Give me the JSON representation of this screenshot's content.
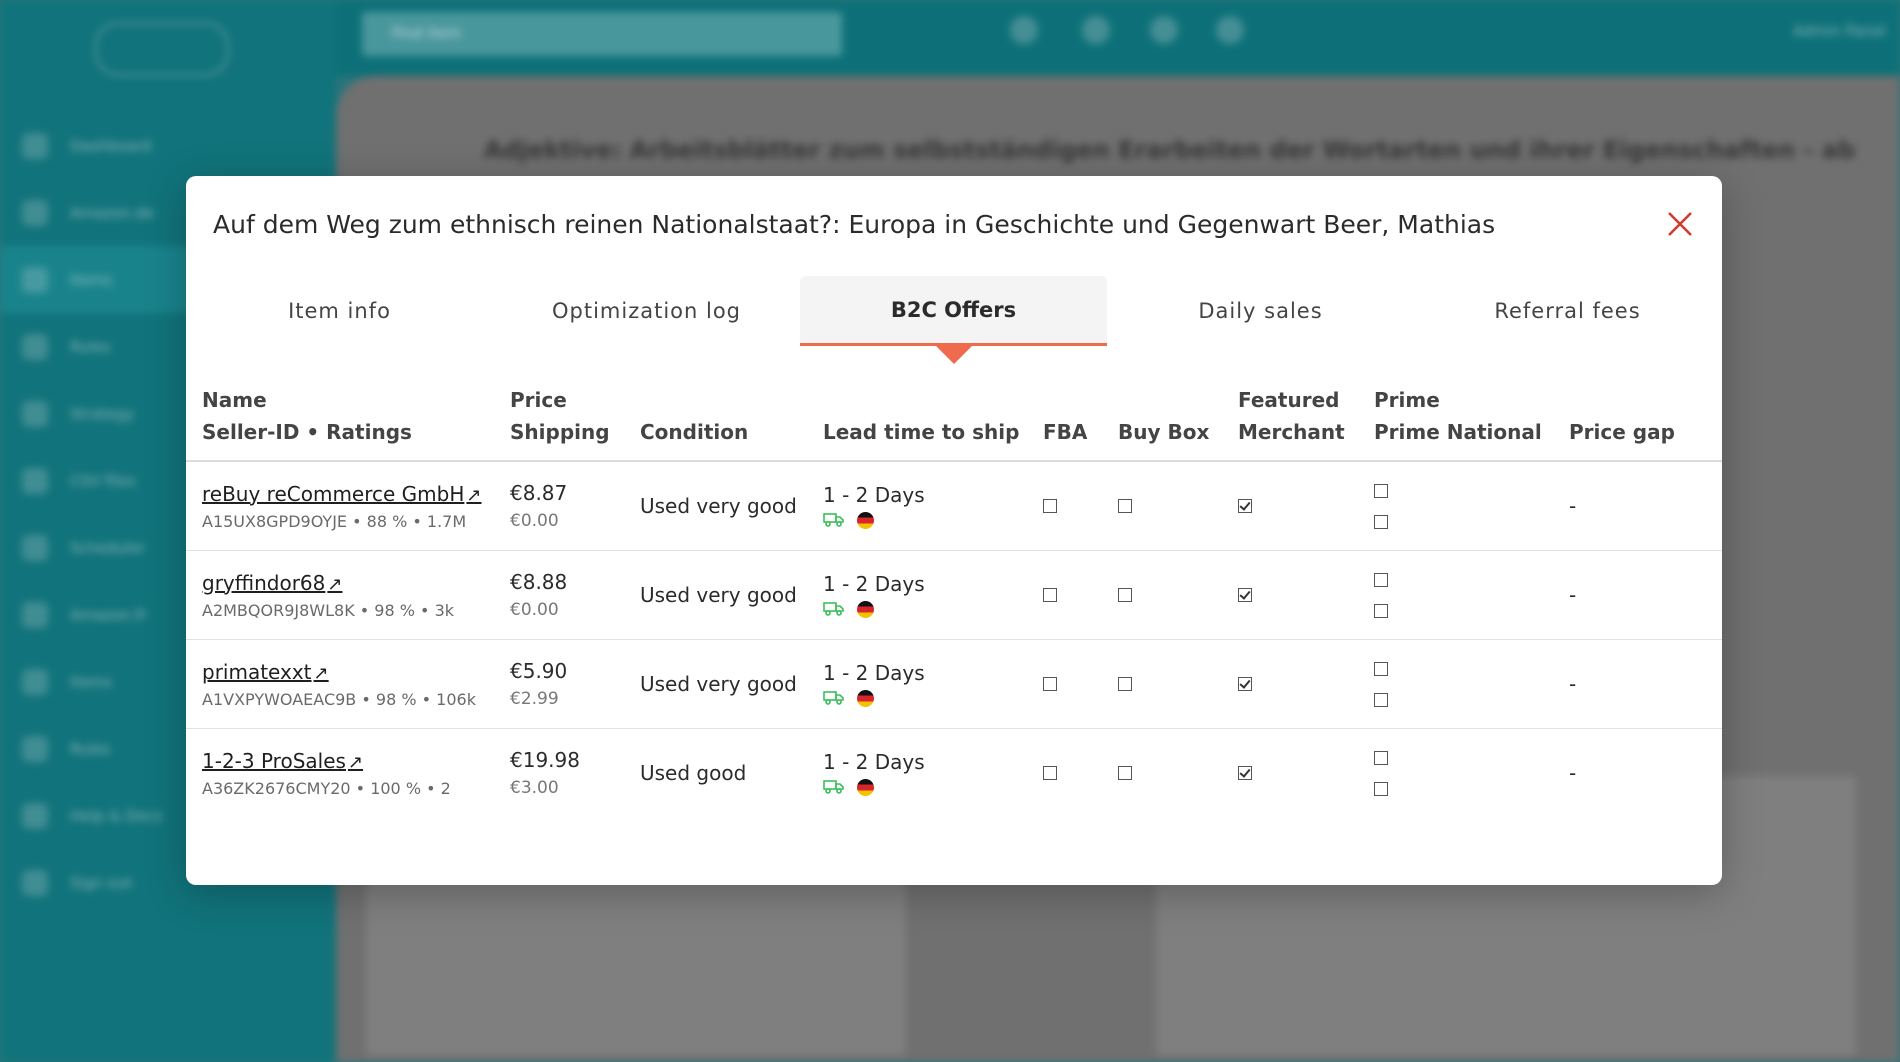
{
  "background": {
    "search_placeholder": "Find item",
    "user_label": "Admin Panel",
    "nav_items": [
      "Dashboard",
      "Amazon.de",
      "Items",
      "Rules",
      "Strategy",
      "CSV files",
      "Scheduler",
      "Amazon.fr",
      "Items",
      "Rules",
      "Help & Docs",
      "Sign out"
    ],
    "main_title": "Adjektive: Arbeitsblätter zum selbstständigen Erarbeiten der Wortarten und ihrer Eigenschaften - ab"
  },
  "modal": {
    "title": "Auf dem Weg zum ethnisch reinen Nationalstaat?: Europa in Geschichte und Gegenwart Beer, Mathias",
    "close_icon": "close-icon",
    "tabs": [
      {
        "label": "Item info",
        "active": false
      },
      {
        "label": "Optimization log",
        "active": false
      },
      {
        "label": "B2C Offers",
        "active": true
      },
      {
        "label": "Daily sales",
        "active": false
      },
      {
        "label": "Referral fees",
        "active": false
      }
    ],
    "columns": {
      "name_line1": "Name",
      "name_line2": "Seller-ID • Ratings",
      "price_line1": "Price",
      "price_line2": "Shipping",
      "condition": "Condition",
      "lead_time": "Lead time to ship",
      "fba": "FBA",
      "buy_box": "Buy Box",
      "featured_line1": "Featured",
      "featured_line2": "Merchant",
      "prime_line1": "Prime",
      "prime_line2": "Prime National",
      "price_gap": "Price gap"
    },
    "offers": [
      {
        "name": "reBuy reCommerce GmbH",
        "ext_icon": "↗",
        "sub": "A15UX8GPD9OYJE • 88 % • 1.7M",
        "price": "€8.87",
        "shipping": "€0.00",
        "condition": "Used very good",
        "lead_time": "1 - 2 Days",
        "fba": false,
        "buy_box": false,
        "featured": true,
        "prime": false,
        "prime_national": false,
        "price_gap": "-"
      },
      {
        "name": "gryffindor68",
        "ext_icon": "↗",
        "sub": "A2MBQOR9J8WL8K • 98 % • 3k",
        "price": "€8.88",
        "shipping": "€0.00",
        "condition": "Used very good",
        "lead_time": "1 - 2 Days",
        "fba": false,
        "buy_box": false,
        "featured": true,
        "prime": false,
        "prime_national": false,
        "price_gap": "-"
      },
      {
        "name": "primatexxt",
        "ext_icon": "↗",
        "sub": "A1VXPYWOAEAC9B • 98 % • 106k",
        "price": "€5.90",
        "shipping": "€2.99",
        "condition": "Used very good",
        "lead_time": "1 - 2 Days",
        "fba": false,
        "buy_box": false,
        "featured": true,
        "prime": false,
        "prime_national": false,
        "price_gap": "-"
      },
      {
        "name": "1-2-3 ProSales",
        "ext_icon": "↗",
        "sub": "A36ZK2676CMY20 • 100 % • 2",
        "price": "€19.98",
        "shipping": "€3.00",
        "condition": "Used good",
        "lead_time": "1 - 2 Days",
        "fba": false,
        "buy_box": false,
        "featured": true,
        "prime": false,
        "prime_national": false,
        "price_gap": "-"
      }
    ]
  },
  "colors": {
    "brand_teal": "#137d86",
    "active_tab_accent": "#ef6b4e",
    "close_red": "#d23a2a",
    "truck_green": "#3bbf5a"
  }
}
